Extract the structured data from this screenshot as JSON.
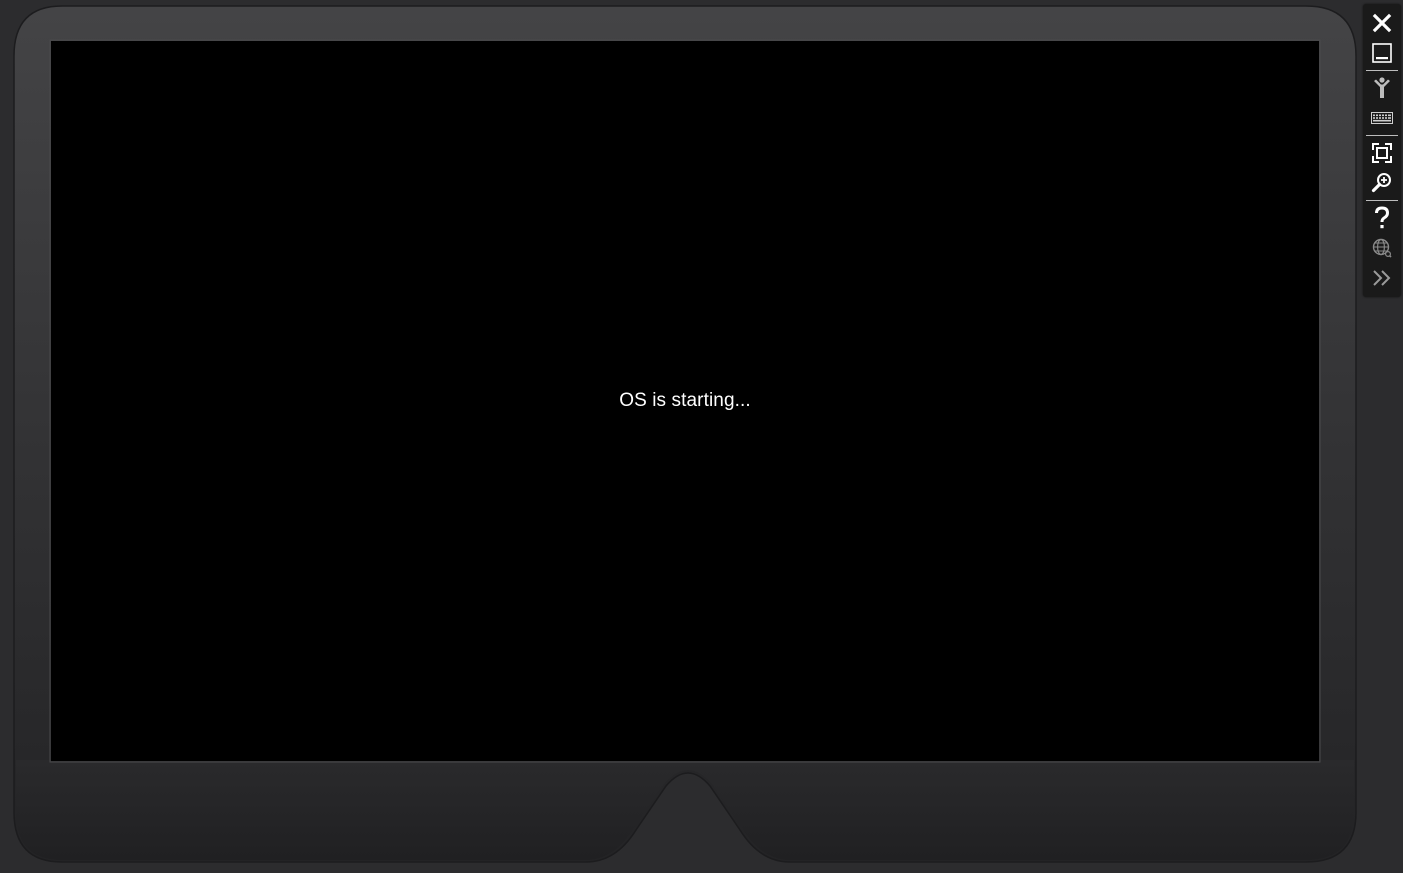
{
  "screen": {
    "boot_message": "OS is starting..."
  },
  "toolbar": {
    "items": [
      {
        "name": "close",
        "icon": "close-icon"
      },
      {
        "name": "minimize",
        "icon": "minimize-icon"
      },
      {
        "name": "rotate",
        "icon": "rotate-device-icon"
      },
      {
        "name": "keyboard",
        "icon": "keyboard-icon"
      },
      {
        "name": "fit-to-screen",
        "icon": "fit-screen-icon"
      },
      {
        "name": "zoom",
        "icon": "zoom-icon"
      },
      {
        "name": "help",
        "icon": "help-icon"
      },
      {
        "name": "network",
        "icon": "globe-icon"
      },
      {
        "name": "additional-tools",
        "icon": "double-chevron-right-icon"
      }
    ]
  },
  "colors": {
    "frame": "#3a3a3c",
    "frame_bottom": "#242426",
    "screen": "#000000",
    "toolbar": "#1a1a1a",
    "icon": "#ffffff"
  }
}
